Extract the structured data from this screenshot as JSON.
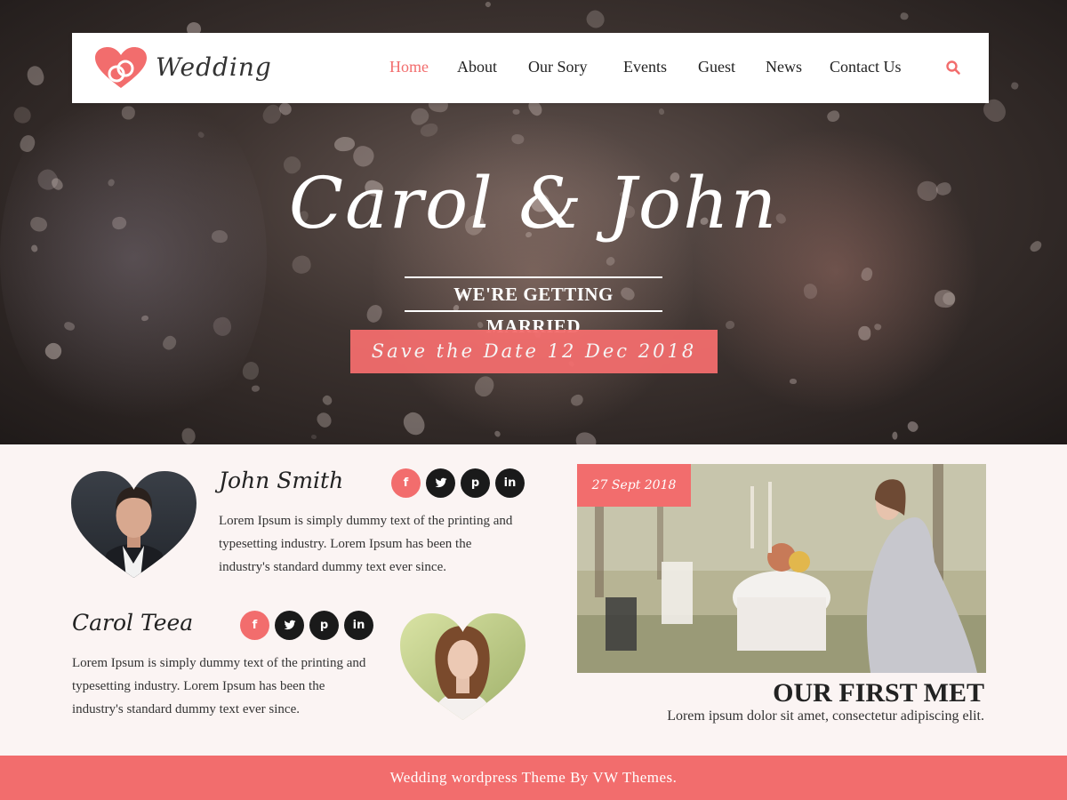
{
  "brand": {
    "logo_text": "Wedding",
    "accent_color": "#f26d6d"
  },
  "nav": {
    "items": [
      {
        "label": "Home",
        "active": true
      },
      {
        "label": "About"
      },
      {
        "label": "Our Sory"
      },
      {
        "label": "Events"
      },
      {
        "label": "Guest"
      },
      {
        "label": "News"
      },
      {
        "label": "Contact Us"
      }
    ],
    "search_icon": "search-icon"
  },
  "hero": {
    "title": "Carol & John",
    "subtitle": "WE'RE GETTING MARRIED",
    "date_label": "Save the Date 12 Dec 2018"
  },
  "profiles": [
    {
      "name": "John Smith",
      "text": "Lorem Ipsum is simply dummy text of the printing and typesetting industry. Lorem Ipsum has been the industry's standard dummy text ever since.",
      "social": [
        "f",
        "t",
        "p",
        "in"
      ]
    },
    {
      "name": "Carol Teea",
      "text": "Lorem Ipsum is simply dummy text of the printing and typesetting industry. Lorem Ipsum has been the industry's standard dummy text ever since.",
      "social": [
        "f",
        "t",
        "p",
        "in"
      ]
    }
  ],
  "first_met": {
    "date": "27 Sept 2018",
    "title": "OUR FIRST MET",
    "text": "Lorem ipsum dolor sit amet, consectetur adipiscing elit."
  },
  "footer": {
    "text": "Wedding wordpress Theme By VW Themes."
  }
}
